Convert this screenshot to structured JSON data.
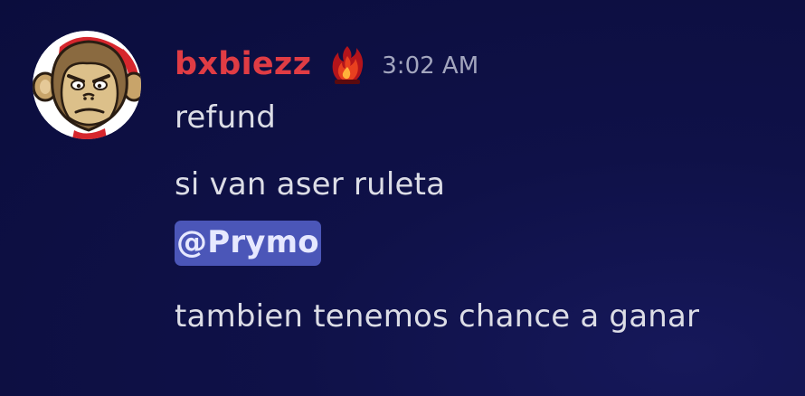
{
  "message": {
    "author": "bxbiezz",
    "timestamp": "3:02 AM",
    "author_color": "#e03c44",
    "avatar_icon": "monkey-avatar-icon",
    "badge_icon": "flame-role-badge-icon",
    "lines": [
      "refund",
      "si van aser ruleta",
      "@Prymo",
      "tambien tenemos chance a ganar"
    ]
  },
  "colors": {
    "background": "#0f1148",
    "text": "#dcdde6",
    "timestamp": "#a3a6be",
    "mention_bg": "#4b56b8"
  }
}
